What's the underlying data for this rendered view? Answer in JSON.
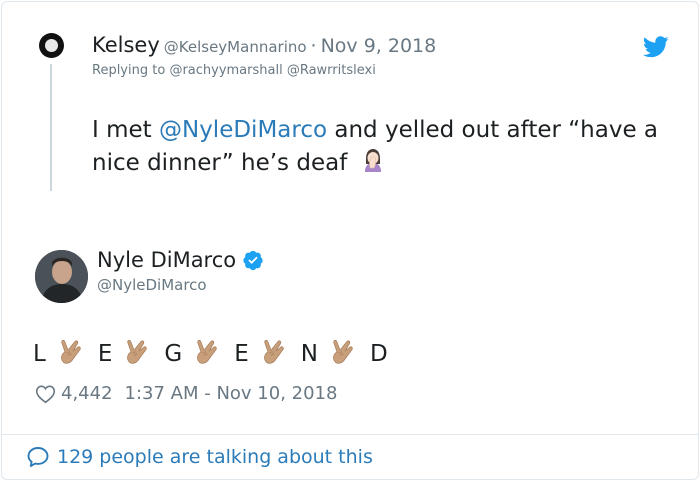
{
  "parent_tweet": {
    "name": "Kelsey",
    "handle": "@KelseyMannarino",
    "separator": "·",
    "date": "Nov 9, 2018",
    "replying_prefix": "Replying to",
    "reply_mentions": "@rachyymarshall @Rawrritslexi",
    "text_before": "I met ",
    "mention": "@NyleDiMarco",
    "text_after": " and yelled out after “have a nice dinner” he’s deaf",
    "emoji": "woman-facepalming-icon"
  },
  "reply_tweet": {
    "name": "Nyle DiMarco",
    "handle": "@NyleDiMarco",
    "letters": [
      "L",
      "E",
      "G",
      "E",
      "N",
      "D"
    ],
    "emoji": "love-you-gesture-icon",
    "likes": "4,442",
    "timestamp": "1:37 AM - Nov 10, 2018"
  },
  "footer": {
    "talking": "129 people are talking about this"
  },
  "colors": {
    "link": "#2b7bb9",
    "muted": "#697882",
    "twitter_blue": "#1da1f2",
    "skin": "#c9a07c"
  }
}
